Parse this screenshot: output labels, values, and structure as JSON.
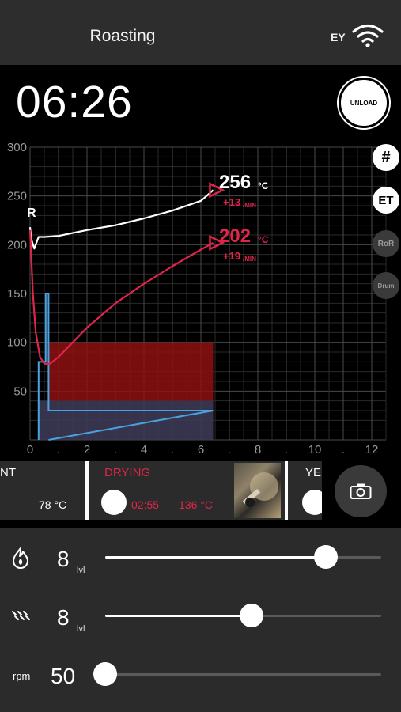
{
  "header": {
    "title": "Roasting",
    "status_text": "EY"
  },
  "timer": "06:26",
  "unload_label": "UNLOAD",
  "chart": {
    "y_ticks": [
      "300",
      "250",
      "200",
      "150",
      "100",
      "50"
    ],
    "x_ticks": [
      "0",
      ".",
      "2",
      ".",
      "4",
      ".",
      "6",
      ".",
      "8",
      ".",
      "10",
      ".",
      "12"
    ],
    "bean_temp": {
      "value": "256",
      "unit": "°C",
      "ror": "+13",
      "ror_unit": "/MIN",
      "color": "#ffffff"
    },
    "env_temp": {
      "value": "202",
      "unit": "°C",
      "ror": "+19",
      "ror_unit": "/MIN",
      "color": "#e0254a"
    },
    "side_buttons": {
      "grid": "#",
      "et": "ET",
      "ror": "RoR",
      "drum": "Drum"
    },
    "start_marker": "R"
  },
  "chart_data": {
    "type": "line",
    "x_range": [
      0,
      12.5
    ],
    "y_range": [
      0,
      300
    ],
    "series": [
      {
        "x": [
          0,
          0.05,
          0.15,
          0.3,
          0.5,
          1,
          2,
          3,
          4,
          5,
          6,
          6.2,
          6.43
        ],
        "values": [
          218,
          205,
          196,
          208,
          208,
          209,
          215,
          220,
          227,
          235,
          245,
          250,
          256
        ]
      },
      {
        "x": [
          0,
          0.1,
          0.2,
          0.35,
          0.5,
          0.7,
          1,
          1.5,
          2,
          3,
          4,
          5,
          6,
          6.43
        ],
        "values": [
          215,
          150,
          110,
          85,
          78,
          78,
          85,
          100,
          115,
          140,
          160,
          178,
          195,
          202
        ]
      }
    ],
    "heat_setting_x": [
      0.3,
      0.55,
      0.55,
      0.65,
      0.65,
      6.43
    ],
    "heat_setting_values": [
      80,
      80,
      150,
      150,
      30,
      30
    ],
    "heat_zone": {
      "x": [
        0.65,
        6.43
      ],
      "values": [
        40,
        100
      ]
    }
  },
  "phases": [
    {
      "name": "NT",
      "temp": "78 °C"
    },
    {
      "name": "DRYING",
      "time": "02:55",
      "temp": "136 °C"
    },
    {
      "name": "YE"
    }
  ],
  "controls": {
    "heat": {
      "value": "8",
      "unit": "lvl",
      "level": 0.8
    },
    "fan": {
      "value": "8",
      "unit": "lvl",
      "level": 0.53
    },
    "drum": {
      "label": "rpm",
      "value": "50",
      "level": 0.0
    }
  },
  "colors": {
    "accent_red": "#e0254a",
    "phase_red": "#e0254a",
    "grid": "#3d3d3d"
  }
}
